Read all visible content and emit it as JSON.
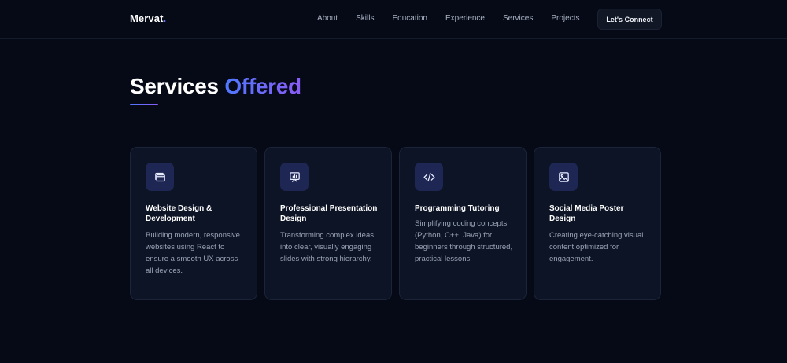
{
  "nav": {
    "logo": "Mervat",
    "logo_dot": ".",
    "links": [
      "About",
      "Skills",
      "Education",
      "Experience",
      "Services",
      "Projects"
    ],
    "cta": "Let's Connect"
  },
  "section": {
    "title_main": "Services",
    "title_accent": "Offered"
  },
  "services": [
    {
      "icon": "browser-windows-icon",
      "title": "Website Design & Development",
      "description": "Building modern, responsive websites using React to ensure a smooth UX across all devices."
    },
    {
      "icon": "presentation-board-icon",
      "title": "Professional Presentation Design",
      "description": "Transforming complex ideas into clear, visually engaging slides with strong hierarchy."
    },
    {
      "icon": "code-icon",
      "title": "Programming Tutoring",
      "description": "Simplifying coding concepts (Python, C++, Java) for beginners through structured, practical lessons."
    },
    {
      "icon": "image-icon",
      "title": "Social Media Poster Design",
      "description": "Creating eye-catching visual content optimized for engagement."
    }
  ],
  "colors": {
    "background": "#050a16",
    "card": "#0d1426",
    "icon_tile": "#1e2653",
    "accent_start": "#4f78ff",
    "accent_end": "#8a5cf6"
  }
}
